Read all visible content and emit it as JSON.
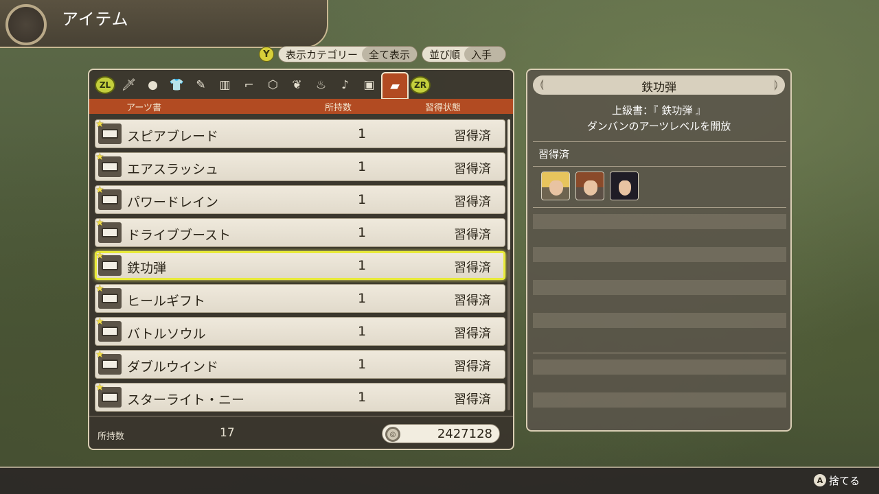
{
  "header": {
    "title": "アイテム"
  },
  "filter": {
    "button": "Y",
    "category_label": "表示カテゴリー",
    "category_value": "全て表示",
    "sort_label": "並び順",
    "sort_value": "入手"
  },
  "tabs": {
    "left_shoulder": "ZL",
    "right_shoulder": "ZR",
    "items": [
      {
        "icon": "sword-icon",
        "glyph": "🗡"
      },
      {
        "icon": "head-icon",
        "glyph": "●"
      },
      {
        "icon": "shirt-icon",
        "glyph": "👕"
      },
      {
        "icon": "arm-icon",
        "glyph": "✎"
      },
      {
        "icon": "legs-icon",
        "glyph": "▥"
      },
      {
        "icon": "boot-icon",
        "glyph": "⌐"
      },
      {
        "icon": "gem-icon",
        "glyph": "⬡"
      },
      {
        "icon": "crystal-icon",
        "glyph": "❦"
      },
      {
        "icon": "ingredient-icon",
        "glyph": "♨"
      },
      {
        "icon": "note-icon",
        "glyph": "♪"
      },
      {
        "icon": "treasure-icon",
        "glyph": "▣"
      },
      {
        "icon": "book-icon",
        "glyph": "▰",
        "active": true
      }
    ]
  },
  "table": {
    "headers": {
      "name": "アーツ書",
      "count": "所持数",
      "status": "習得状態"
    },
    "rows": [
      {
        "name": "スピアブレード",
        "count": "1",
        "status": "習得済"
      },
      {
        "name": "エアスラッシュ",
        "count": "1",
        "status": "習得済"
      },
      {
        "name": "パワードレイン",
        "count": "1",
        "status": "習得済"
      },
      {
        "name": "ドライブブースト",
        "count": "1",
        "status": "習得済"
      },
      {
        "name": "鉄功弾",
        "count": "1",
        "status": "習得済",
        "selected": true
      },
      {
        "name": "ヒールギフト",
        "count": "1",
        "status": "習得済"
      },
      {
        "name": "バトルソウル",
        "count": "1",
        "status": "習得済"
      },
      {
        "name": "ダブルウインド",
        "count": "1",
        "status": "習得済"
      },
      {
        "name": "スターライト・ニー",
        "count": "1",
        "status": "習得済"
      }
    ]
  },
  "footer": {
    "owned_label": "所持数",
    "owned_count": "17",
    "money": "2427128"
  },
  "detail": {
    "title": "鉄功弾",
    "line1": "上級書：『 鉄功弾 』",
    "line2": "ダンバンのアーツレベルを開放",
    "learned_label": "習得済",
    "characters": [
      "blonde-character",
      "brown-haired-character",
      "black-haired-character"
    ]
  },
  "bottom": {
    "button": "A",
    "action": "捨てる"
  },
  "colors": {
    "accent_orange": "#b24b22",
    "selection_yellow": "#e8ea3a",
    "button_y": "#d7cf3a",
    "shoulder_green": "#c4cf3c"
  }
}
